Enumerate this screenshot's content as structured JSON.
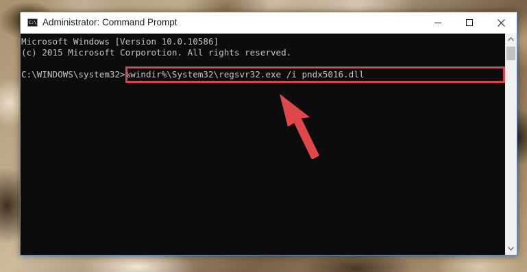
{
  "window": {
    "title": "Administrator: Command Prompt",
    "icon": "command-prompt-icon",
    "icon_text": "C:\\.",
    "controls": {
      "minimize": "minimize-icon",
      "maximize": "maximize-icon",
      "close": "close-icon"
    }
  },
  "console": {
    "lines": [
      "Microsoft Windows [Version 10.0.10586]",
      "(c) 2015 Microsoft Corporotion. All rights reserved."
    ],
    "prompt": "C:\\WINDOWS\\system32>",
    "command": "%windir%\\System32\\regsvr32.exe /i pndx5016.dll"
  },
  "annotation": {
    "highlight_color": "#d9434a",
    "arrow_color": "#e0474c",
    "arrow_icon": "pointer-arrow-icon"
  },
  "scrollbar": {
    "up": "scroll-up-icon",
    "down": "scroll-down-icon"
  }
}
